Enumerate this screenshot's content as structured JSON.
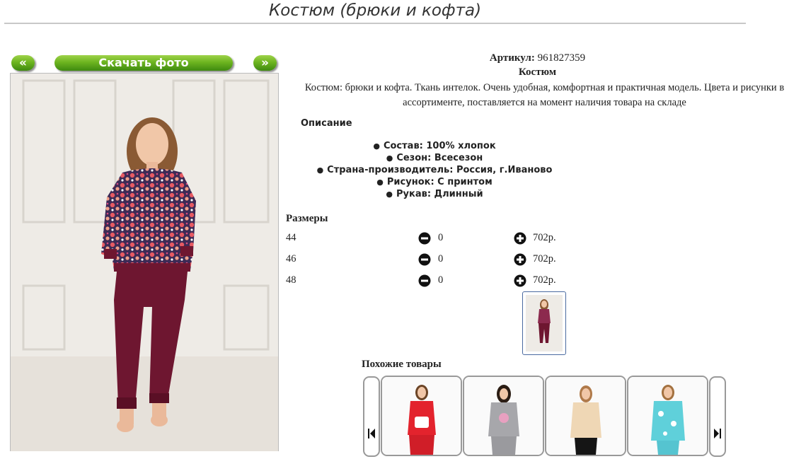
{
  "page": {
    "title": "Костюм (брюки и кофта)"
  },
  "gallery": {
    "prev_label": "«",
    "download_label": "Скачать фото",
    "next_label": "»"
  },
  "product": {
    "article_label": "Артикул:",
    "article_value": "961827359",
    "name": "Костюм",
    "description": "Костюм: брюки и кофта. Ткань интелок. Очень удобная, комфортная и практичная модель. Цвета и рисунки в ассортименте, поставляется на момент наличия товара на складе",
    "description_heading": "Описание",
    "specs": [
      "Состав: 100% хлопок",
      "Сезон: Всесезон",
      "Страна-производитель: Россия, г.Иваново",
      "Рисунок: С принтом",
      "Рукав: Длинный"
    ]
  },
  "sizes": {
    "heading": "Размеры",
    "rows": [
      {
        "size": "44",
        "qty": "0",
        "price": "702р."
      },
      {
        "size": "46",
        "qty": "0",
        "price": "702р."
      },
      {
        "size": "48",
        "qty": "0",
        "price": "702р."
      }
    ]
  },
  "similar": {
    "heading": "Похожие товары",
    "prev_icon": "skip-back-icon",
    "next_icon": "skip-forward-icon"
  },
  "colors": {
    "button_green": "#6db520",
    "pants": "#6e1630",
    "top_print": "#8c2a4e"
  }
}
